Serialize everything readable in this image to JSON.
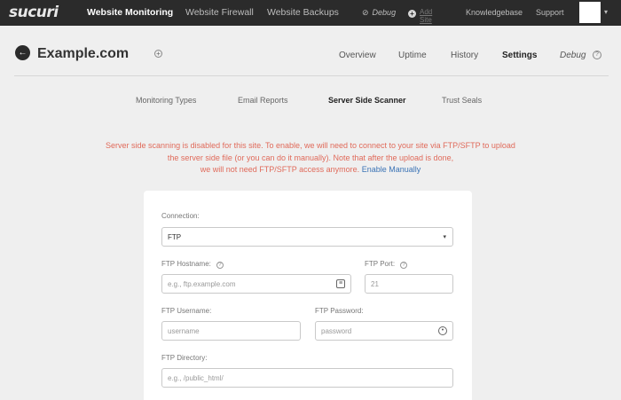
{
  "nav": {
    "logo": "sucuri",
    "items": [
      "Website Monitoring",
      "Website Firewall",
      "Website Backups"
    ],
    "debug": "Debug",
    "debug_icon": "⊘",
    "add_site": "Add Site",
    "knowledgebase": "Knowledgebase",
    "support": "Support"
  },
  "site": {
    "title": "Example.com",
    "tabs": [
      "Overview",
      "Uptime",
      "History",
      "Settings",
      "Debug"
    ]
  },
  "subtabs": [
    "Monitoring Types",
    "Email Reports",
    "Server Side Scanner",
    "Trust Seals"
  ],
  "warning": {
    "line1": "Server side scanning is disabled for this site. To enable, we will need to connect to your site via FTP/SFTP to upload",
    "line2": "the server side file (or you can do it manually). Note that after the upload is done,",
    "line3": "we will not need FTP/SFTP access anymore.",
    "link": "Enable Manually"
  },
  "form": {
    "connection_label": "Connection:",
    "connection_value": "FTP",
    "hostname_label": "FTP Hostname:",
    "hostname_placeholder": "e.g., ftp.example.com",
    "port_label": "FTP Port:",
    "port_value": "21",
    "username_label": "FTP Username:",
    "username_placeholder": "username",
    "password_label": "FTP Password:",
    "password_placeholder": "password",
    "directory_label": "FTP Directory:",
    "directory_placeholder": "e.g., /public_html/"
  },
  "colors": {
    "topbar": "#2b2b2b",
    "warning": "#e06a5a",
    "link": "#3a73b5"
  }
}
